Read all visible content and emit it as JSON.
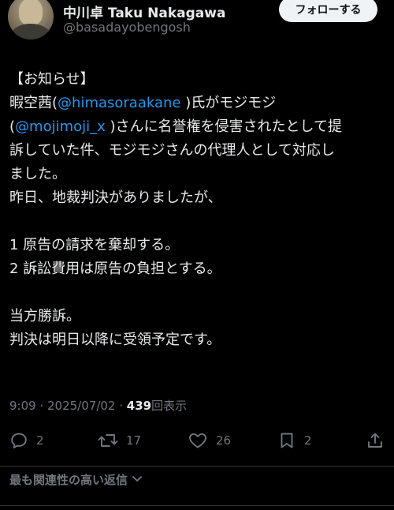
{
  "user": {
    "name": "中川卓 Taku Nakagawa",
    "handle": "@basadayobengosh"
  },
  "follow_label": "フォローする",
  "tweet": {
    "line1": "【お知らせ】",
    "line2_pre": "暇空茜(",
    "line2_mention": "@himasoraakane",
    "line2_post": " )氏がモジモジ",
    "line3_pre": "(",
    "line3_mention": "@mojimoji_x",
    "line3_post": " )さんに名誉権を侵害されたとして提",
    "line4": "訴していた件、モジモジさんの代理人として対応し",
    "line5": "ました。",
    "line6": "昨日、地裁判決がありましたが、",
    "line7": "1 原告の請求を棄却する。",
    "line8": "2 訴訟費用は原告の負担とする。",
    "line9": "当方勝訴。",
    "line10": "判決は明日以降に受領予定です。"
  },
  "meta": {
    "time": "9:09",
    "separator": " · ",
    "date": "2025/07/02",
    "views": "439",
    "views_label": "回表示"
  },
  "actions": {
    "replies": "2",
    "retweets": "17",
    "likes": "26",
    "bookmarks": "2"
  },
  "sort_label": "最も関連性の高い返信",
  "colors": {
    "background": "#000000",
    "text": "#e7e9ea",
    "secondary": "#71767b",
    "link": "#1d9bf0"
  },
  "icons": [
    "reply-icon",
    "retweet-icon",
    "like-icon",
    "bookmark-icon",
    "share-icon",
    "chevron-down-icon"
  ]
}
